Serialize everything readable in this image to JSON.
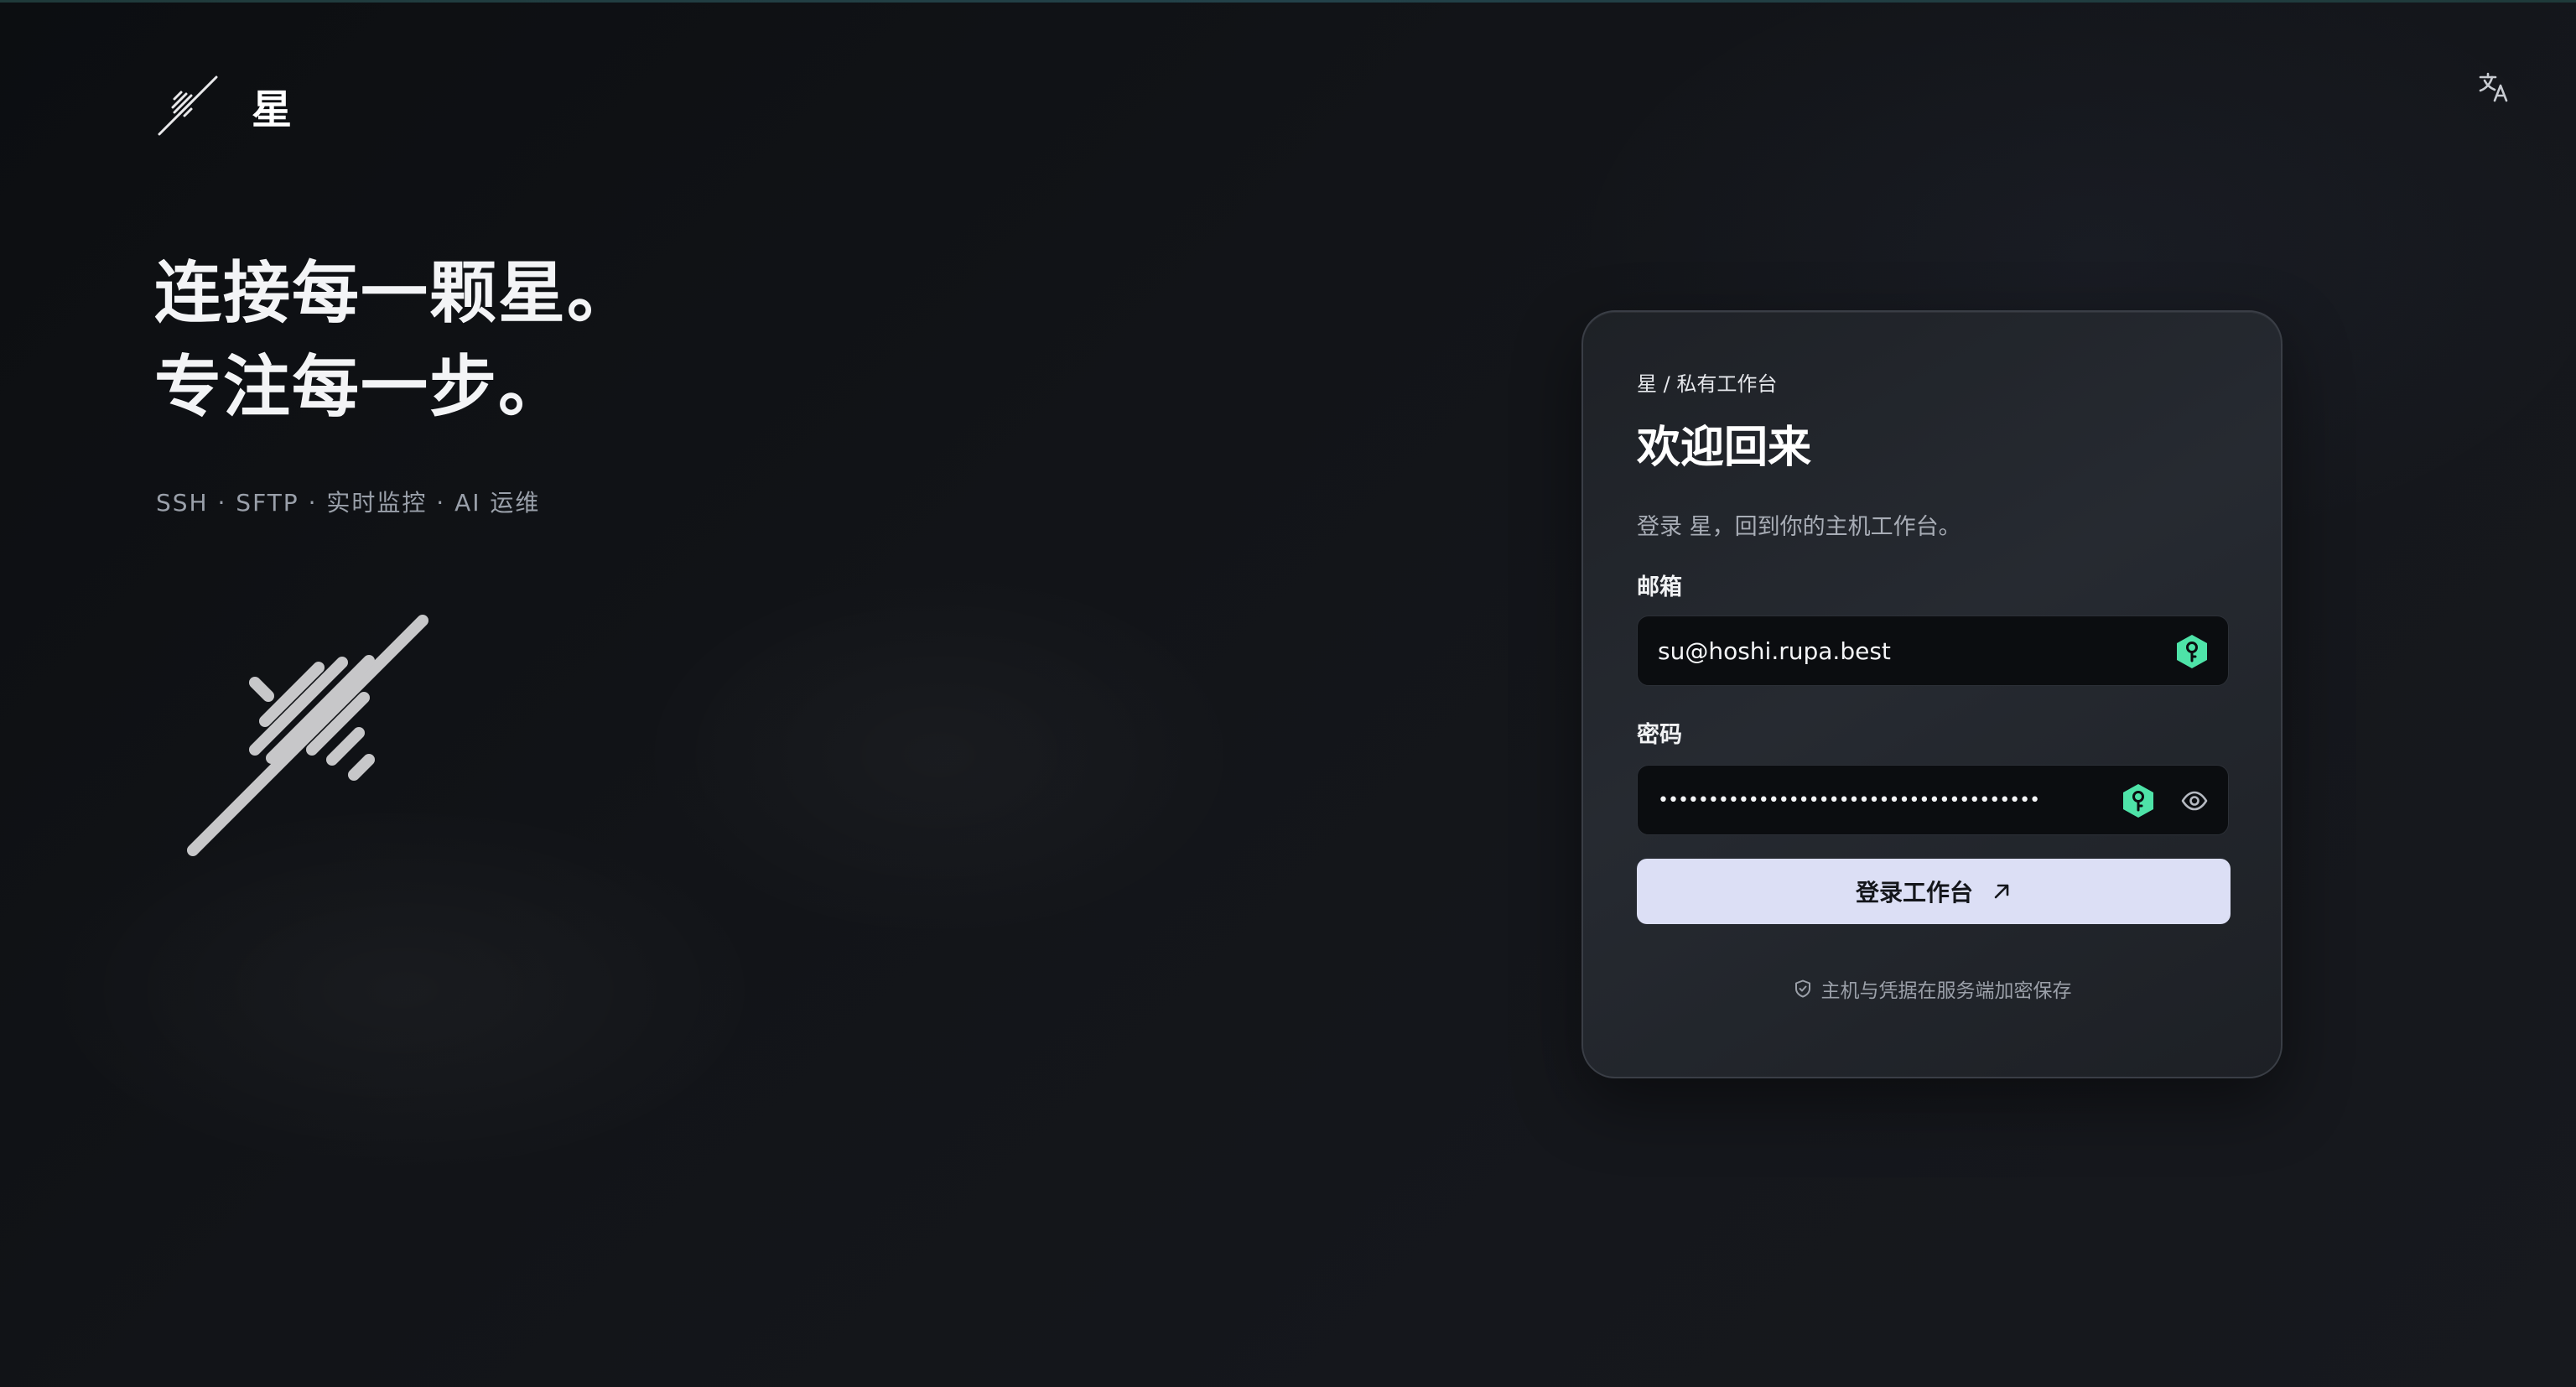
{
  "brand": {
    "name": "星"
  },
  "hero": {
    "line1": "连接每一颗星。",
    "line2": "专注每一步。",
    "tagline": "SSH · SFTP · 实时监控 · AI 运维"
  },
  "card": {
    "breadcrumb": "星 / 私有工作台",
    "title": "欢迎回来",
    "subtitle": "登录 星，回到你的主机工作台。",
    "email": {
      "label": "邮箱",
      "value": "su@hoshi.rupa.best"
    },
    "password": {
      "label": "密码",
      "value": "••••••••••••••••••••••••••••••••••••••"
    },
    "submit_label": "登录工作台",
    "footnote": "主机与凭据在服务端加密保存"
  },
  "icons": {
    "translate": "translate-icon",
    "password_manager": "key-icon",
    "eye": "eye-icon",
    "arrow": "arrow-up-right-icon",
    "shield": "shield-check-icon"
  },
  "colors": {
    "accent_button": "#dcdff5",
    "key_badge": "#4ee3a8",
    "background": "#121418"
  }
}
